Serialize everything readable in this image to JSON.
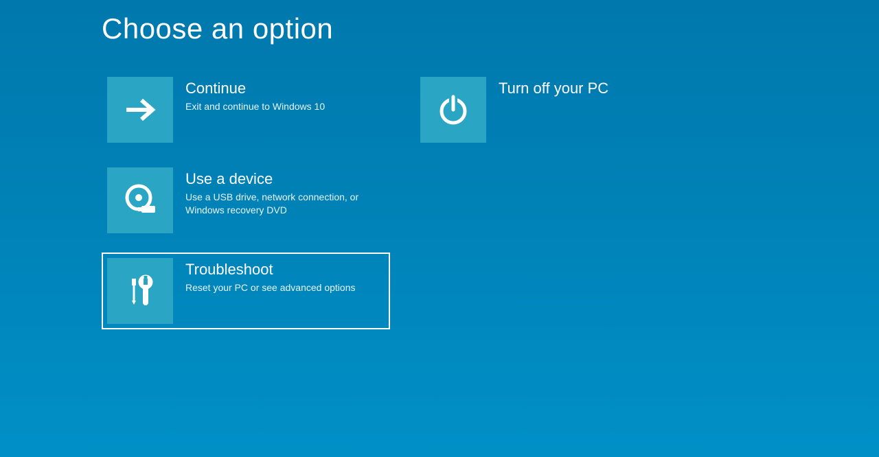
{
  "page": {
    "title": "Choose an option"
  },
  "options": {
    "continue": {
      "title": "Continue",
      "subtitle": "Exit and continue to Windows 10"
    },
    "use_device": {
      "title": "Use a device",
      "subtitle": "Use a USB drive, network connection, or Windows recovery DVD"
    },
    "troubleshoot": {
      "title": "Troubleshoot",
      "subtitle": "Reset your PC or see advanced options",
      "selected": true
    },
    "turn_off": {
      "title": "Turn off your PC"
    }
  },
  "colors": {
    "background_top": "#0078ad",
    "background_bottom": "#0090c7",
    "tile_bg": "#2ba5c4",
    "text": "#ffffff"
  }
}
